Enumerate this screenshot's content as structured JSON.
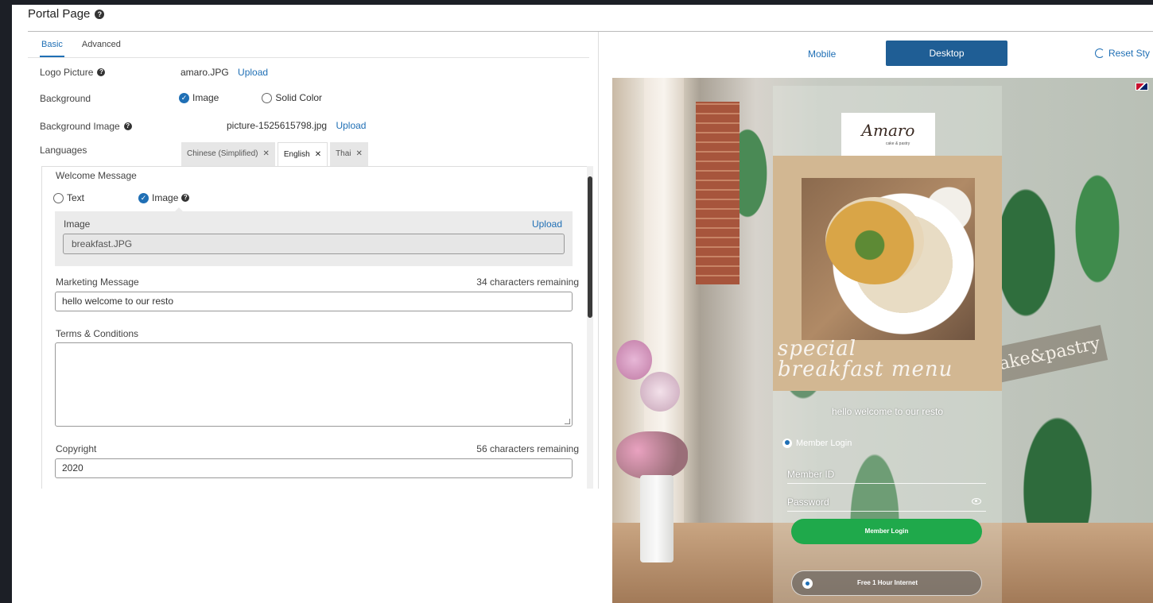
{
  "page": {
    "title": "Portal Page"
  },
  "editor": {
    "tabs": [
      {
        "label": "Basic",
        "active": true
      },
      {
        "label": "Advanced",
        "active": false
      }
    ],
    "logo_picture": {
      "label": "Logo Picture",
      "file": "amaro.JPG",
      "upload": "Upload"
    },
    "background": {
      "label": "Background",
      "options": [
        "Image",
        "Solid Color"
      ],
      "selected": "Image"
    },
    "background_image": {
      "label": "Background Image",
      "file": "picture-1525615798.jpg",
      "upload": "Upload"
    },
    "languages": {
      "label": "Languages",
      "tabs": [
        {
          "label": "Chinese (Simplified)",
          "active": false
        },
        {
          "label": "English",
          "active": true
        },
        {
          "label": "Thai",
          "active": false
        }
      ],
      "close_glyph": "✕"
    },
    "welcome_message": {
      "label": "Welcome Message",
      "options": [
        "Text",
        "Image"
      ],
      "selected": "Image",
      "image_label": "Image",
      "image_upload": "Upload",
      "image_file": "breakfast.JPG"
    },
    "marketing_message": {
      "label": "Marketing Message",
      "remaining": "34 characters remaining",
      "value": "hello welcome to our resto"
    },
    "terms": {
      "label": "Terms & Conditions",
      "value": ""
    },
    "copyright": {
      "label": "Copyright",
      "remaining": "56 characters remaining",
      "value": "2020"
    }
  },
  "preview": {
    "view_modes": {
      "mobile": "Mobile",
      "desktop": "Desktop",
      "selected": "Desktop"
    },
    "reset_label": "Reset Sty",
    "portal": {
      "logo_text": "Amaro",
      "logo_sub": "cake & pastry",
      "promo_line1": "special",
      "promo_line2": "breakfast menu",
      "welcome_text": "hello welcome to our resto",
      "member_heading": "Member Login",
      "member_id_placeholder": "Member ID",
      "password_placeholder": "Password",
      "login_button": "Member Login",
      "free_button": "Free 1 Hour Internet"
    },
    "background_sign_text": "ake&pastry"
  },
  "colors": {
    "accent": "#1f6fb5",
    "desktop_button": "#1f5e95",
    "login_green": "#1fa94b",
    "frame": "#1c1f26"
  },
  "icons": [
    "help-icon",
    "check-circle-icon",
    "radio-empty-icon",
    "close-icon",
    "reset-icon",
    "uk-flag-icon",
    "user-icon",
    "eye-icon",
    "wifi-icon"
  ]
}
